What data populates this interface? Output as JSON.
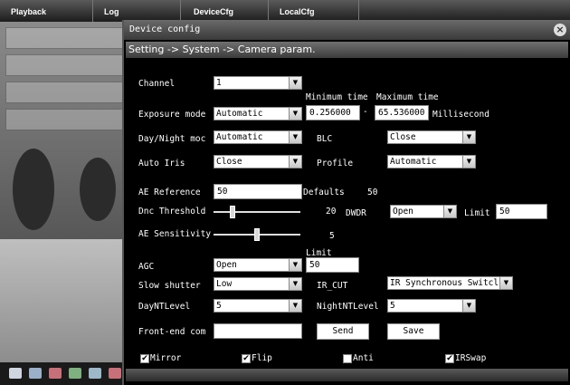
{
  "top_tabs": [
    "Playback",
    "Log",
    "DeviceCfg",
    "LocalCfg"
  ],
  "dialog": {
    "title": "Device config",
    "breadcrumb": "Setting -> System -> Camera param."
  },
  "form": {
    "channel": {
      "label": "Channel",
      "value": "1"
    },
    "exposure_mode": {
      "label": "Exposure mode",
      "value": "Automatic"
    },
    "min_time": {
      "label": "Minimum time",
      "value": "0.256000"
    },
    "max_time": {
      "label": "Maximum time",
      "value": "65.536000"
    },
    "time_sep": "-",
    "millisecond_label": "Millisecond",
    "day_night": {
      "label": "Day/Night moc",
      "value": "Automatic"
    },
    "blc": {
      "label": "BLC",
      "value": "Close"
    },
    "auto_iris": {
      "label": "Auto Iris",
      "value": "Close"
    },
    "profile": {
      "label": "Profile",
      "value": "Automatic"
    },
    "ae_reference": {
      "label": "AE Reference",
      "value": "50",
      "defaults_label": "Defaults",
      "defaults_value": "50"
    },
    "dnc_threshold": {
      "label": "Dnc Threshold",
      "value": "20",
      "level": 0.2
    },
    "dwdr": {
      "label": "DWDR",
      "value": "Open",
      "limit_label": "Limit",
      "limit_value": "50"
    },
    "ae_sensitivity": {
      "label": "AE Sensitivity",
      "value": "5",
      "level": 0.5
    },
    "agc": {
      "label": "AGC",
      "value": "Open",
      "limit_label": "Limit",
      "limit_value": "50"
    },
    "slow_shutter": {
      "label": "Slow shutter",
      "value": "Low"
    },
    "ir_cut": {
      "label": "IR_CUT",
      "value": "IR Synchronous Switcl"
    },
    "day_nt_level": {
      "label": "DayNTLevel",
      "value": "5"
    },
    "night_nt_level": {
      "label": "NightNTLevel",
      "value": "5"
    },
    "front_end": {
      "label": "Front-end com",
      "value": ""
    },
    "send_label": "Send",
    "save_label": "Save",
    "checkboxes": [
      {
        "label": "Mirror",
        "checked": true
      },
      {
        "label": "Flip",
        "checked": true
      },
      {
        "label": "Anti",
        "checked": false
      },
      {
        "label": "IRSwap",
        "checked": true
      }
    ]
  },
  "toolbar_icons": [
    "fullscreen-icon",
    "camera-icon",
    "record-icon",
    "image-icon",
    "grid-icon",
    "record-icon"
  ]
}
